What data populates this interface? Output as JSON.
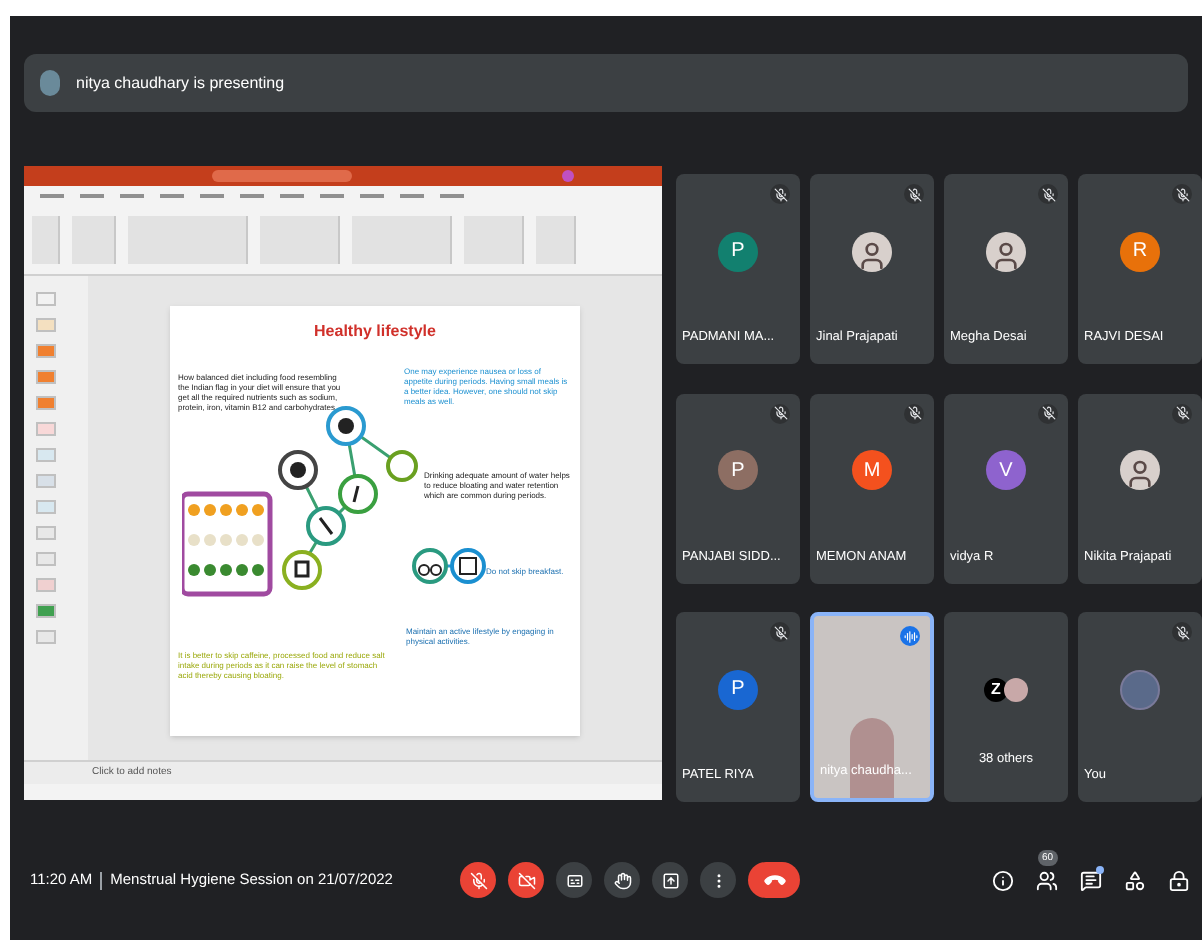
{
  "presenting_banner": {
    "text": "nitya chaudhary is presenting"
  },
  "shared_screen": {
    "slide": {
      "title": "Healthy lifestyle",
      "texts": [
        "How balanced diet including food resembling the Indian flag in your diet will ensure that you get all the required nutrients such as sodium, protein, iron, vitamin B12 and carbohydrates.",
        "One may experience nausea or loss of appetite during periods. Having small meals is a better idea. However, one should not skip meals as well.",
        "Drinking adequate amount of water helps to reduce bloating and water retention which are common during periods.",
        "Do not skip breakfast.",
        "Maintain an active lifestyle by engaging in physical activities.",
        "It is better to skip caffeine, processed food and reduce salt intake during periods as it can raise the level of stomach acid thereby causing bloating."
      ]
    },
    "notes_placeholder": "Click to add notes"
  },
  "participants": [
    {
      "name": "PADMANI MA...",
      "kind": "initial",
      "initial": "P",
      "color": "#12806f",
      "muted": true,
      "speaking": false
    },
    {
      "name": "Jinal Prajapati",
      "kind": "photo",
      "muted": true,
      "speaking": false
    },
    {
      "name": "Megha Desai",
      "kind": "photo",
      "muted": true,
      "speaking": false
    },
    {
      "name": "RAJVI DESAI",
      "kind": "initial",
      "initial": "R",
      "color": "#e8710a",
      "muted": true,
      "speaking": false
    },
    {
      "name": "PANJABI SIDD...",
      "kind": "initial",
      "initial": "P",
      "color": "#8d6e63",
      "muted": true,
      "speaking": false
    },
    {
      "name": "MEMON ANAM",
      "kind": "initial",
      "initial": "M",
      "color": "#f4511e",
      "muted": true,
      "speaking": false
    },
    {
      "name": "vidya R",
      "kind": "initial",
      "initial": "V",
      "color": "#8e63ce",
      "muted": true,
      "speaking": false
    },
    {
      "name": "Nikita Prajapati",
      "kind": "photo",
      "muted": true,
      "speaking": false
    },
    {
      "name": "PATEL RIYA",
      "kind": "initial",
      "initial": "P",
      "color": "#1967d2",
      "muted": true,
      "speaking": false
    },
    {
      "name": "nitya chaudha...",
      "kind": "video",
      "muted": false,
      "speaking": true
    },
    {
      "name": "38 others",
      "kind": "others",
      "initial": "Z",
      "muted": false,
      "speaking": false
    },
    {
      "name": "You",
      "kind": "image",
      "muted": true,
      "speaking": false
    }
  ],
  "meeting": {
    "time": "11:20 AM",
    "title": "Menstrual Hygiene Session on 21/07/2022"
  },
  "controls": [
    {
      "kind": "mic",
      "off": true
    },
    {
      "kind": "camera",
      "off": true
    },
    {
      "kind": "captions",
      "off": false
    },
    {
      "kind": "hand",
      "off": false
    },
    {
      "kind": "present",
      "off": false
    },
    {
      "kind": "more",
      "off": false
    },
    {
      "kind": "leave",
      "off": true
    }
  ],
  "side_buttons": [
    {
      "kind": "info"
    },
    {
      "kind": "people",
      "badge": "60"
    },
    {
      "kind": "chat",
      "unread": true
    },
    {
      "kind": "activities"
    },
    {
      "kind": "host"
    }
  ]
}
